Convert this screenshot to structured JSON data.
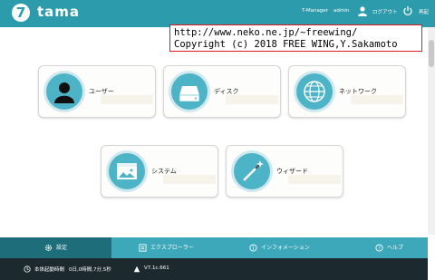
{
  "header": {
    "logo_letter": "7",
    "app_name": "tama",
    "role": "T-Manager",
    "user": "admin",
    "logout_label": "ログアウト",
    "shutdown_label": "再起"
  },
  "copyright_overlay": {
    "line1": "http://www.neko.ne.jp/~freewing/",
    "line2": "Copyright (c) 2018 FREE WING,Y.Sakamoto"
  },
  "tiles": [
    {
      "label": "ユーザー",
      "icon": "user-icon"
    },
    {
      "label": "ディスク",
      "icon": "disk-icon"
    },
    {
      "label": "ネットワーク",
      "icon": "globe-icon"
    },
    {
      "label": "システム",
      "icon": "system-window-icon"
    },
    {
      "label": "ウィザード",
      "icon": "magic-wand-icon"
    }
  ],
  "bottom_nav": [
    {
      "label": "設定",
      "icon": "gear-icon",
      "active": true
    },
    {
      "label": "エクスプローラー",
      "icon": "explorer-icon",
      "active": false
    },
    {
      "label": "インフォメーション",
      "icon": "info-icon",
      "active": false
    },
    {
      "label": "ヘルプ",
      "icon": "help-icon",
      "active": false
    }
  ],
  "status": {
    "uptime_label": "本体起動時間",
    "uptime_value": "0日,0時間,7分,5秒",
    "version": "V7.1c.661"
  },
  "colors": {
    "header": "#2c9bab",
    "nav": "#3da8ba",
    "nav_active": "#1d6d7a",
    "statusbar": "#1c2a30",
    "tile_icon": "#4db3c6"
  }
}
